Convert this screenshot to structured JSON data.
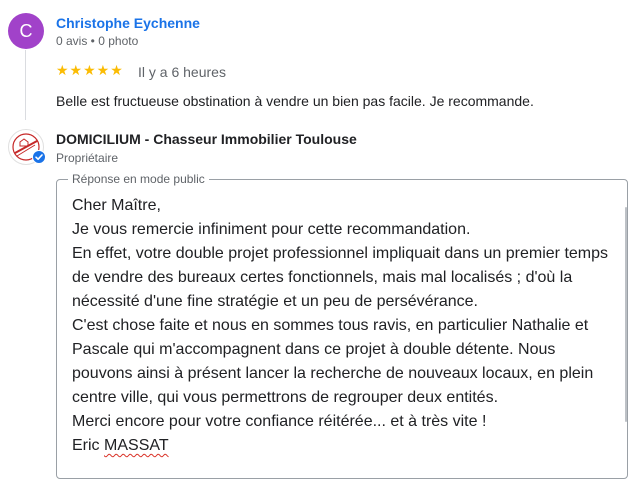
{
  "review": {
    "avatar_letter": "C",
    "reviewer_name": "Christophe Eychenne",
    "reviewer_meta": "0 avis • 0 photo",
    "stars": "★★★★★",
    "rating": 5,
    "date": "Il y a 6 heures",
    "text": "Belle est fructueuse obstination à vendre un bien pas facile. Je recommande.",
    "colors": {
      "avatar_bg": "#a142c9",
      "name": "#1a73e8",
      "stars": "#fbbc04"
    }
  },
  "owner_reply": {
    "owner_name": "DOMICILIUM - Chasseur Immobilier Toulouse",
    "owner_role": "Propriétaire",
    "logo_icon": "domicilium-logo",
    "badge_icon": "verified-check-icon",
    "field_label": "Réponse en mode public",
    "lines": [
      "Cher Maître,",
      "Je vous remercie infiniment pour cette recommandation.",
      "En effet, votre double projet professionnel impliquait dans un premier temps de vendre des bureaux certes fonctionnels, mais mal localisés ; d'où la nécessité d'une fine stratégie et un peu de persévérance.",
      "C'est chose faite et nous en sommes tous ravis, en particulier Nathalie et Pascale qui m'accompagnent dans ce projet à double détente. Nous pouvons ainsi à présent lancer la recherche de nouveaux locaux, en plein centre ville, qui vous permettrons de regrouper deux entités.",
      "Merci encore pour votre confiance réitérée... et à très vite !"
    ],
    "signature_first": "Eric",
    "signature_last": "MASSAT"
  }
}
